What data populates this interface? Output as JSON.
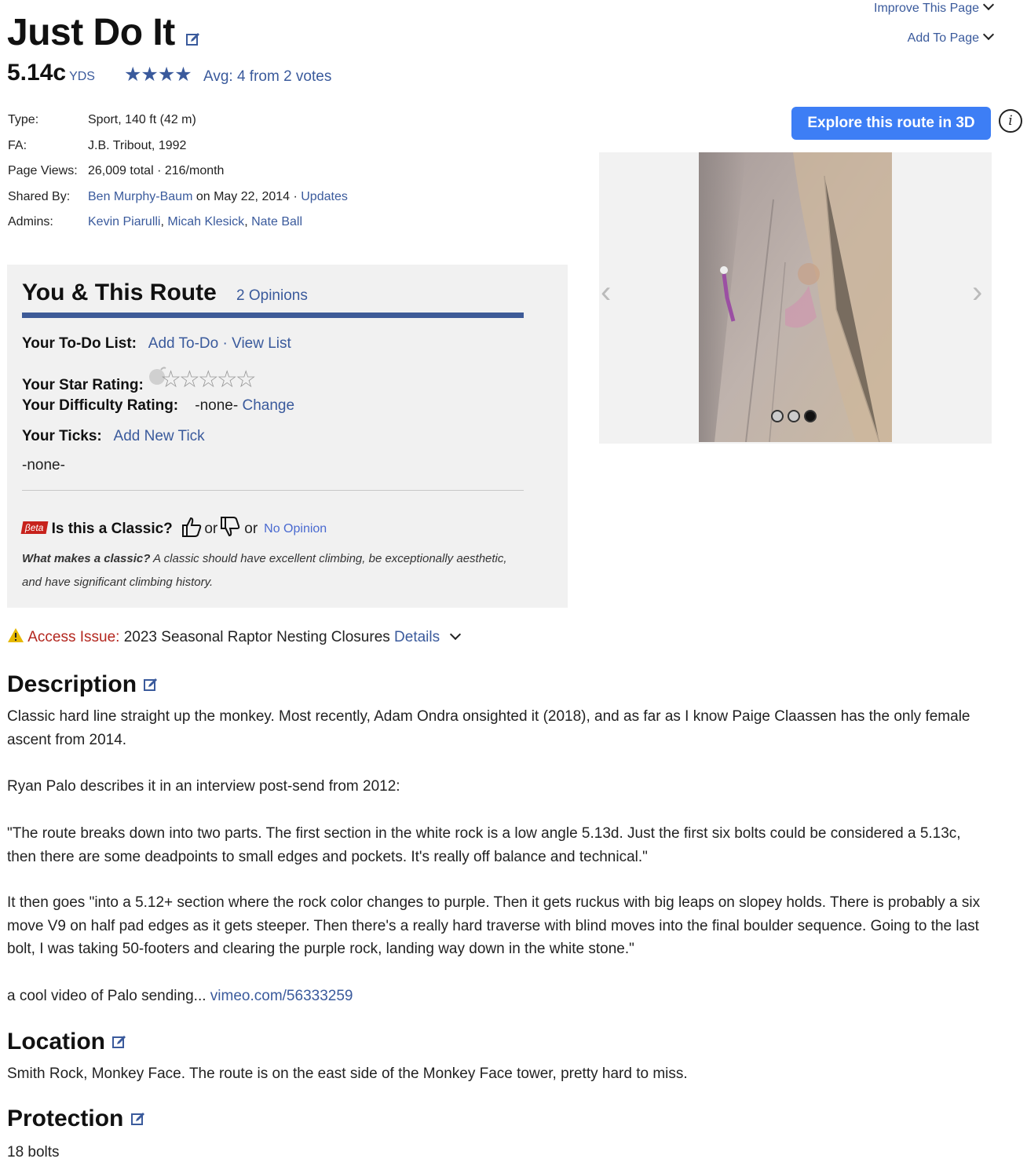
{
  "route": {
    "name": "Just Do It",
    "grade": "5.14c",
    "grade_system": "YDS",
    "stars": "★★★★",
    "rating_text": "Avg: 4 from 2 votes"
  },
  "top_menu": {
    "improve": "Improve This Page",
    "add": "Add To Page"
  },
  "info": {
    "type_label": "Type:",
    "type_value": "Sport, 140 ft (42 m)",
    "fa_label": "FA:",
    "fa_value": "J.B. Tribout, 1992",
    "views_label": "Page Views:",
    "views_value": "26,009 total · 216/month",
    "shared_label": "Shared By:",
    "shared_user": "Ben Murphy-Baum",
    "shared_date": " on May 22, 2014 · ",
    "shared_updates": "Updates",
    "admins_label": "Admins:",
    "admin1": "Kevin Piarulli",
    "admin2": "Micah Klesick",
    "admin3": "Nate Ball",
    "sep": ", "
  },
  "you_route": {
    "title": "You & This Route",
    "opinions": "2 Opinions",
    "todo_label": "Your To-Do List:",
    "add_todo": "Add To-Do",
    "dot_sep": " · ",
    "view_list": "View List",
    "star_label": "Your Star Rating:",
    "empty_stars": "☆☆☆☆☆",
    "difficulty_label": "Your Difficulty Rating:",
    "difficulty_value": "-none-",
    "change": "Change",
    "ticks_label": "Your Ticks:",
    "add_tick": "Add New Tick",
    "ticks_value": "-none-",
    "beta": "βeta",
    "classic_q": "Is this a Classic?",
    "or1": "or",
    "or2": "or",
    "no_opinion": "No Opinion",
    "classic_note_bold": "What makes a classic?",
    "classic_note": " A classic should have excellent climbing, be exceptionally aesthetic, and have significant climbing history."
  },
  "explore_button": "Explore this route in 3D",
  "access": {
    "label": "Access Issue:",
    "text": " 2023 Seasonal Raptor Nesting Closures ",
    "details": "Details"
  },
  "description": {
    "heading": "Description",
    "p1": "Classic hard line straight up the monkey. Most recently, Adam Ondra onsighted it (2018), and as far as I know Paige Claassen has the only female ascent from 2014.",
    "p2": "Ryan Palo describes it in an interview post-send from 2012:",
    "p3": "\"The route breaks down into two parts. The first section in the white rock is a low angle 5.13d. Just the first six bolts could be considered a 5.13c, then there are some deadpoints to small edges and pockets. It's really off balance and technical.\"",
    "p4": "It then goes \"into a 5.12+ section where the rock color changes to purple. Then it gets ruckus with big leaps on slopey holds. There is probably a six move V9 on half pad edges as it gets steeper. Then there's a really hard traverse with blind moves into the final boulder sequence. Going to the last bolt, I was taking 50-footers and clearing the purple rock, landing way down in the white stone.\"",
    "p5_text": "a cool video of Palo sending... ",
    "p5_link": "vimeo.com/56333259"
  },
  "location": {
    "heading": "Location",
    "text": "Smith Rock, Monkey Face. The route is on the east side of the Monkey Face tower, pretty hard to miss."
  },
  "protection": {
    "heading": "Protection",
    "text": "18 bolts"
  }
}
